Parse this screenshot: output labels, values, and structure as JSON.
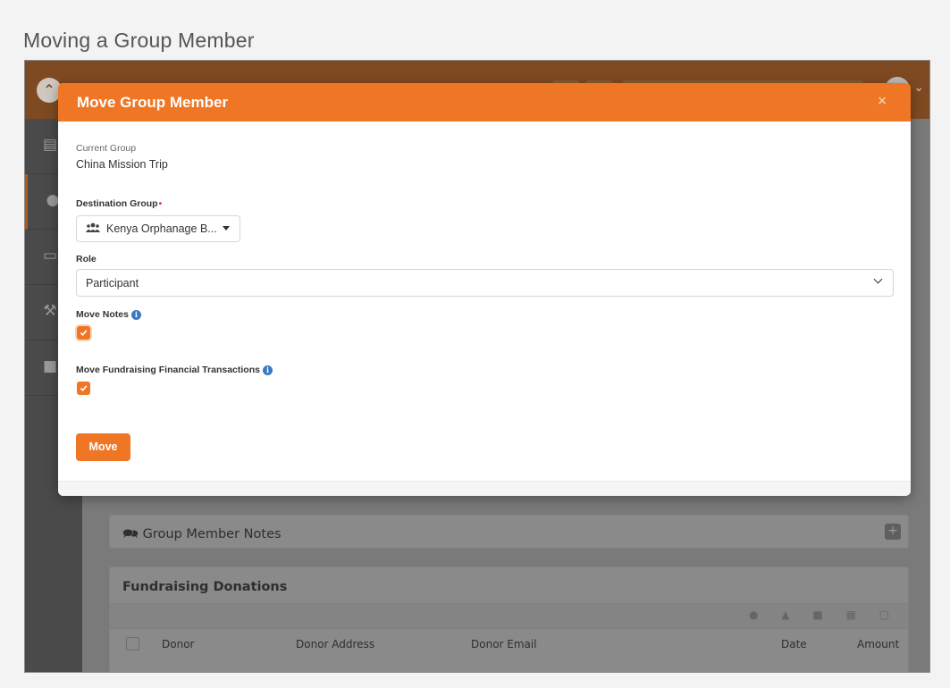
{
  "page": {
    "heading": "Moving a Group Member"
  },
  "modal": {
    "title": "Move Group Member",
    "close_symbol": "×",
    "current_group_label": "Current Group",
    "current_group_value": "China Mission Trip",
    "destination_label": "Destination Group",
    "required_marker": "•",
    "destination_value": "Kenya Orphanage B...",
    "role_label": "Role",
    "role_value": "Participant",
    "move_notes_label": "Move Notes",
    "move_notes_checked": true,
    "move_fundraising_label": "Move Fundraising Financial Transactions",
    "move_fundraising_checked": true,
    "move_button": "Move",
    "info_symbol": "i"
  },
  "background": {
    "notes_panel_title": "Group Member Notes",
    "donations_panel_title": "Fundraising Donations",
    "donation_columns": [
      "Donor",
      "Donor Address",
      "Donor Email",
      "Date",
      "Amount"
    ]
  },
  "colors": {
    "accent": "#ee7625",
    "info": "#3a78c3",
    "required": "#d9363e"
  },
  "icons": [
    "rock-logo-icon",
    "avatar-icon",
    "group-icon",
    "info-icon",
    "close-icon",
    "chevron-down-icon",
    "checkbox-checked-icon",
    "comments-icon",
    "plus-icon"
  ]
}
